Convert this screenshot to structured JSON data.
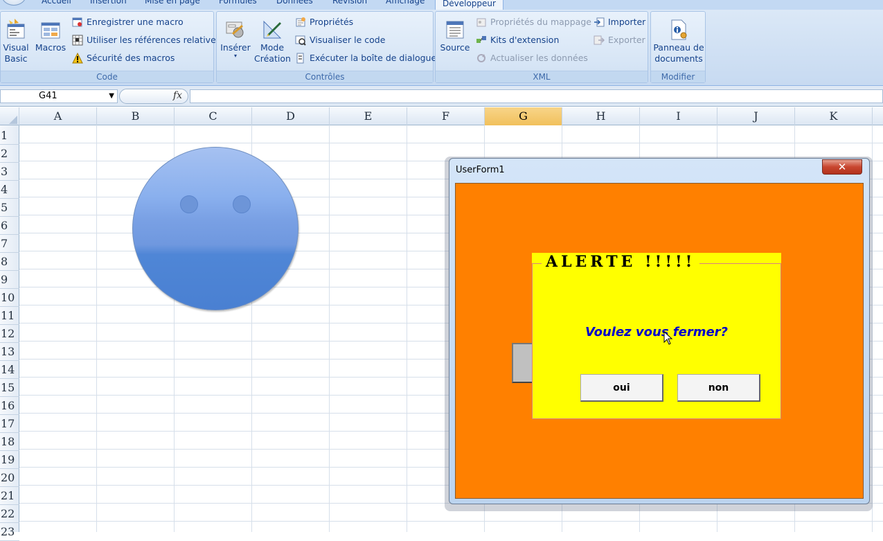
{
  "ribbon": {
    "tabs": [
      {
        "label": "Accueil"
      },
      {
        "label": "Insertion"
      },
      {
        "label": "Mise en page"
      },
      {
        "label": "Formules"
      },
      {
        "label": "Données"
      },
      {
        "label": "Révision"
      },
      {
        "label": "Affichage"
      },
      {
        "label": "Développeur"
      }
    ],
    "active_tab": "Développeur",
    "groups": {
      "code": {
        "label": "Code",
        "visual_basic": "Visual Basic",
        "visual_basic_line1": "Visual",
        "visual_basic_line2": "Basic",
        "macros": "Macros",
        "record_macro": "Enregistrer une macro",
        "relative_refs": "Utiliser les références relatives",
        "macro_security": "Sécurité des macros"
      },
      "controls": {
        "label": "Contrôles",
        "insert": "Insérer",
        "design_mode_line1": "Mode",
        "design_mode_line2": "Création",
        "properties": "Propriétés",
        "view_code": "Visualiser le code",
        "run_dialog": "Exécuter la boîte de dialogue"
      },
      "xml": {
        "label": "XML",
        "source": "Source",
        "map_properties": "Propriétés du mappage",
        "expansion_packs": "Kits d'extension",
        "refresh_data": "Actualiser les données",
        "import": "Importer",
        "export": "Exporter"
      },
      "modify": {
        "label": "Modifier",
        "doc_panel_line1": "Panneau de",
        "doc_panel_line2": "documents"
      }
    }
  },
  "formula_bar": {
    "name_box": "G41",
    "fx": "fx",
    "formula": ""
  },
  "sheet": {
    "columns": [
      "A",
      "B",
      "C",
      "D",
      "E",
      "F",
      "G",
      "H",
      "I",
      "J",
      "K"
    ],
    "selected_column": "G",
    "rows": [
      "1",
      "2",
      "3",
      "4",
      "5",
      "6",
      "7",
      "8",
      "9",
      "10",
      "11",
      "12",
      "13",
      "14",
      "15",
      "16",
      "17",
      "18",
      "19",
      "20",
      "21",
      "22",
      "23"
    ]
  },
  "userform": {
    "title": "UserForm1",
    "close_glyph": "✕",
    "frame_title": "ALERTE  !!!!!",
    "question": "Voulez vous fermer?",
    "yes_label": "oui",
    "no_label": "non"
  },
  "colors": {
    "form_background": "#ff8000",
    "frame_background": "#ffff00",
    "question_color": "#0000cc",
    "smiley_fill": "#6f98df"
  }
}
